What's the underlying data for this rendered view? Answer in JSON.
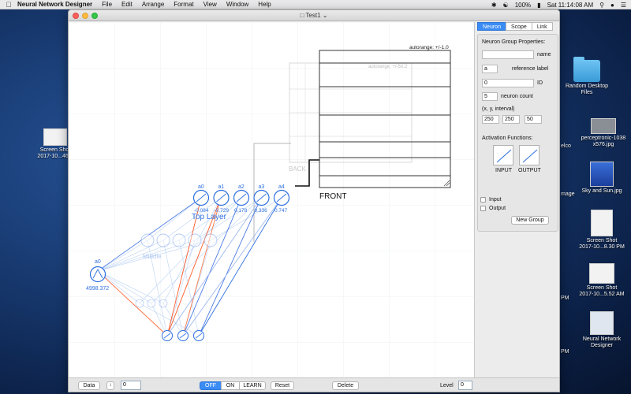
{
  "menubar": {
    "app_name": "Neural Network Designer",
    "items": [
      "File",
      "Edit",
      "Arrange",
      "Format",
      "View",
      "Window",
      "Help"
    ],
    "battery": "100%",
    "clock": "Sat 11:14:08 AM"
  },
  "desktop": {
    "items": [
      {
        "label1": "Screen Shot",
        "label2": "2017-10...46.2"
      },
      {
        "label1": "Random Desktop",
        "label2": "Files"
      },
      {
        "label1": "perceptronic-1038",
        "label2": "x576.jpg"
      },
      {
        "label1": "Sky and Sun.jpg",
        "label2": ""
      },
      {
        "label1": "Screen Shot",
        "label2": "2017-10...8.30 PM"
      },
      {
        "label1": "Screen Shot",
        "label2": "2017-10...5.52 AM"
      },
      {
        "label1": "Neural Network",
        "label2": "Designer"
      }
    ],
    "partial_labels": [
      "elco",
      "mage",
      "PM",
      "PM",
      "PM"
    ]
  },
  "window": {
    "title": "Test1"
  },
  "canvas": {
    "autorange_front": "autorange: +/-1.0",
    "autorange_back": "autorange: +/-50.2",
    "back_label": "BACK",
    "front_label": "FRONT",
    "top_layer": {
      "title": "Top Layer",
      "neurons": [
        {
          "name": "a0",
          "value": "-0.084"
        },
        {
          "name": "a1",
          "value": "-0.729"
        },
        {
          "name": "a2",
          "value": "0.178"
        },
        {
          "name": "a3",
          "value": "0.336"
        },
        {
          "name": "a4",
          "value": "0.747"
        }
      ]
    },
    "middle_layer": {
      "title": "Middle"
    },
    "input_neuron": {
      "name": "a0",
      "value": "4998.372"
    }
  },
  "panel": {
    "tabs": [
      "Neuron",
      "Scope",
      "Link"
    ],
    "active_tab": "Neuron",
    "group_title": "Neuron Group Properties:",
    "name_label": "name",
    "name_value": "",
    "ref_label": "reference label",
    "ref_value": "a",
    "id_label": "ID",
    "id_value": "0",
    "count_label": "neuron count",
    "count_value": "5",
    "xyi_label": "(x, y, interval)",
    "x_value": "250",
    "y_value": "250",
    "interval_value": "50",
    "activation_title": "Activation Functions:",
    "input_fn_label": "INPUT",
    "output_fn_label": "OUTPUT",
    "input_check_label": "Input",
    "output_check_label": "Output",
    "new_group_label": "New Group"
  },
  "bottombar": {
    "data_label": "Data",
    "data_value": "0",
    "off_label": "OFF",
    "on_label": "ON",
    "learn_label": "LEARN",
    "reset_label": "Reset",
    "delete_label": "Delete",
    "level_label": "Level",
    "level_value": "0",
    "mode": "OFF"
  },
  "colors": {
    "accent": "#3b8cf5",
    "neuron_blue": "#2d6fe0",
    "faint_blue": "#b9d2f5",
    "link_red": "#ff5a2a"
  }
}
